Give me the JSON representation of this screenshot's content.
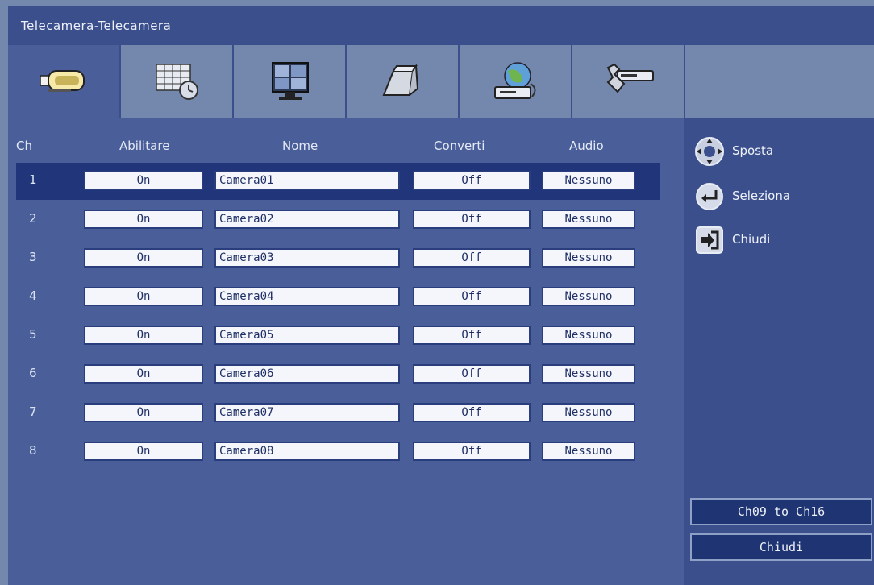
{
  "window": {
    "title": "Telecamera-Telecamera"
  },
  "tabs": [
    {
      "icon": "camera-icon",
      "active": true
    },
    {
      "icon": "schedule-icon",
      "active": false
    },
    {
      "icon": "display-icon",
      "active": false
    },
    {
      "icon": "archive-icon",
      "active": false
    },
    {
      "icon": "network-icon",
      "active": false
    },
    {
      "icon": "tools-icon",
      "active": false
    }
  ],
  "table": {
    "headers": {
      "ch": "Ch",
      "enable": "Abilitare",
      "name": "Nome",
      "convert": "Converti",
      "audio": "Audio"
    },
    "rows": [
      {
        "ch": "1",
        "enable": "On",
        "name": "Camera01",
        "convert": "Off",
        "audio": "Nessuno",
        "selected": true
      },
      {
        "ch": "2",
        "enable": "On",
        "name": "Camera02",
        "convert": "Off",
        "audio": "Nessuno",
        "selected": false
      },
      {
        "ch": "3",
        "enable": "On",
        "name": "Camera03",
        "convert": "Off",
        "audio": "Nessuno",
        "selected": false
      },
      {
        "ch": "4",
        "enable": "On",
        "name": "Camera04",
        "convert": "Off",
        "audio": "Nessuno",
        "selected": false
      },
      {
        "ch": "5",
        "enable": "On",
        "name": "Camera05",
        "convert": "Off",
        "audio": "Nessuno",
        "selected": false
      },
      {
        "ch": "6",
        "enable": "On",
        "name": "Camera06",
        "convert": "Off",
        "audio": "Nessuno",
        "selected": false
      },
      {
        "ch": "7",
        "enable": "On",
        "name": "Camera07",
        "convert": "Off",
        "audio": "Nessuno",
        "selected": false
      },
      {
        "ch": "8",
        "enable": "On",
        "name": "Camera08",
        "convert": "Off",
        "audio": "Nessuno",
        "selected": false
      }
    ]
  },
  "legend": {
    "move": {
      "icon": "dpad-icon",
      "label": "Sposta"
    },
    "select": {
      "icon": "enter-icon",
      "label": "Seleziona"
    },
    "close": {
      "icon": "exit-icon",
      "label": "Chiudi"
    }
  },
  "buttons": {
    "next_page": "Ch09 to Ch16",
    "close": "Chiudi"
  },
  "colors": {
    "background": "#7487ac",
    "title_bar": "#3b4f8c",
    "panel": "#4a5f9a",
    "selected_row": "#20357a",
    "field": "#f4f6fb",
    "field_text": "#1f2f66"
  }
}
